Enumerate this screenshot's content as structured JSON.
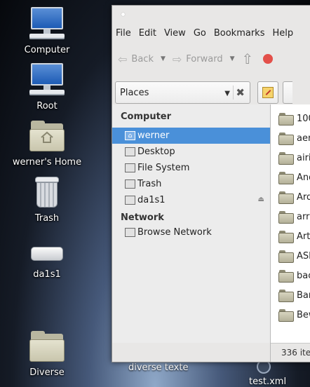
{
  "desktop": {
    "icons": [
      {
        "label": "Computer",
        "icon": "computer-icon"
      },
      {
        "label": "Root",
        "icon": "computer-icon"
      },
      {
        "label": "werner's Home",
        "icon": "home-folder-icon"
      },
      {
        "label": "Trash",
        "icon": "trash-icon"
      },
      {
        "label": "da1s1",
        "icon": "drive-icon"
      },
      {
        "label": "Diverse",
        "icon": "folder-icon"
      }
    ],
    "partial_labels": [
      "diverse texte",
      "test.xml"
    ]
  },
  "window": {
    "menu": [
      "File",
      "Edit",
      "View",
      "Go",
      "Bookmarks",
      "Help"
    ],
    "toolbar": {
      "back": "Back",
      "forward": "Forward"
    },
    "location": {
      "selected": "Places"
    },
    "sidebar": {
      "computer_header": "Computer",
      "computer_items": [
        {
          "label": "werner",
          "icon": "home-icon",
          "selected": true
        },
        {
          "label": "Desktop",
          "icon": "desktop-icon"
        },
        {
          "label": "File System",
          "icon": "filesystem-icon"
        },
        {
          "label": "Trash",
          "icon": "trash-icon"
        },
        {
          "label": "da1s1",
          "icon": "drive-icon"
        }
      ],
      "network_header": "Network",
      "network_items": [
        {
          "label": "Browse Network",
          "icon": "network-icon"
        }
      ]
    },
    "files": [
      "100",
      "aer",
      "airi",
      "And",
      "Ard",
      "arra",
      "Arti",
      "ASI",
      "bac",
      "Ban",
      "Bew"
    ],
    "status": "336 ite"
  }
}
